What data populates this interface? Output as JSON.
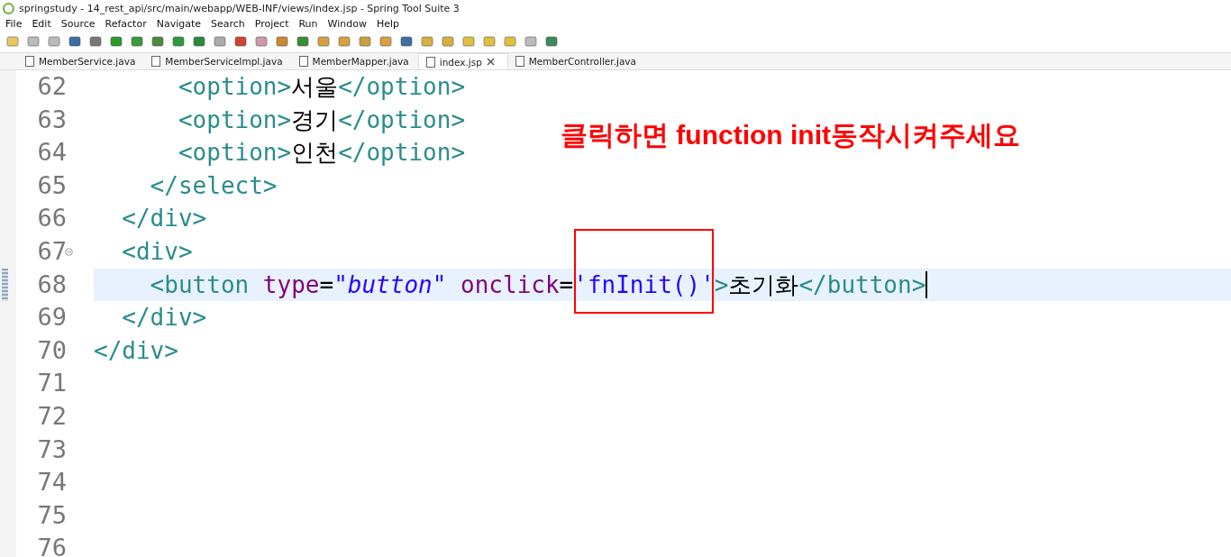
{
  "window": {
    "title": "springstudy - 14_rest_api/src/main/webapp/WEB-INF/views/index.jsp - Spring Tool Suite 3"
  },
  "menu": [
    "File",
    "Edit",
    "Source",
    "Refactor",
    "Navigate",
    "Search",
    "Project",
    "Run",
    "Window",
    "Help"
  ],
  "tabs": [
    {
      "label": "MemberService.java",
      "selected": false
    },
    {
      "label": "MemberServiceImpl.java",
      "selected": false
    },
    {
      "label": "MemberMapper.java",
      "selected": false
    },
    {
      "label": "index.jsp",
      "selected": true
    },
    {
      "label": "MemberController.java",
      "selected": false
    }
  ],
  "editor": {
    "lines": [
      {
        "number": "62",
        "current": false,
        "foldable": false,
        "tokens": [
          {
            "kind": "tag",
            "text": "      <option>"
          },
          {
            "kind": "text",
            "text": "서울"
          },
          {
            "kind": "tag",
            "text": "</option>"
          }
        ]
      },
      {
        "number": "63",
        "current": false,
        "foldable": false,
        "tokens": [
          {
            "kind": "tag",
            "text": "      <option>"
          },
          {
            "kind": "text",
            "text": "경기"
          },
          {
            "kind": "tag",
            "text": "</option>"
          }
        ]
      },
      {
        "number": "64",
        "current": false,
        "foldable": false,
        "tokens": [
          {
            "kind": "tag",
            "text": "      <option>"
          },
          {
            "kind": "text",
            "text": "인천"
          },
          {
            "kind": "tag",
            "text": "</option>"
          }
        ]
      },
      {
        "number": "65",
        "current": false,
        "foldable": false,
        "tokens": [
          {
            "kind": "tag",
            "text": "    </select>"
          }
        ]
      },
      {
        "number": "66",
        "current": false,
        "foldable": false,
        "tokens": [
          {
            "kind": "tag",
            "text": "  </div>"
          }
        ]
      },
      {
        "number": "67",
        "current": false,
        "foldable": true,
        "tokens": [
          {
            "kind": "tag",
            "text": "  <div>"
          }
        ]
      },
      {
        "number": "68",
        "current": true,
        "foldable": false,
        "tokens": [
          {
            "kind": "tag",
            "text": "    <button "
          },
          {
            "kind": "attr",
            "text": "type"
          },
          {
            "kind": "plain",
            "text": "="
          },
          {
            "kind": "string",
            "text": "\"button\" "
          },
          {
            "kind": "attr",
            "text": "onclick"
          },
          {
            "kind": "plain",
            "text": "="
          },
          {
            "kind": "value",
            "text": "'fnInit()'"
          },
          {
            "kind": "tag",
            "text": ">"
          },
          {
            "kind": "text",
            "text": "초기화"
          },
          {
            "kind": "tag",
            "text": "</button>"
          }
        ]
      },
      {
        "number": "69",
        "current": false,
        "foldable": false,
        "tokens": [
          {
            "kind": "tag",
            "text": "  </div>"
          }
        ]
      },
      {
        "number": "70",
        "current": false,
        "foldable": false,
        "tokens": [
          {
            "kind": "tag",
            "text": "</div>"
          }
        ]
      },
      {
        "number": "71",
        "current": false,
        "foldable": false
      },
      {
        "number": "72",
        "current": false,
        "foldable": false
      },
      {
        "number": "73",
        "current": false,
        "foldable": false
      },
      {
        "number": "74",
        "current": false,
        "foldable": false
      },
      {
        "number": "75",
        "current": false,
        "foldable": false
      },
      {
        "number": "76",
        "current": false,
        "foldable": false
      }
    ]
  },
  "annotation": {
    "text": "클릭하면 function init동작시켜주세요"
  }
}
